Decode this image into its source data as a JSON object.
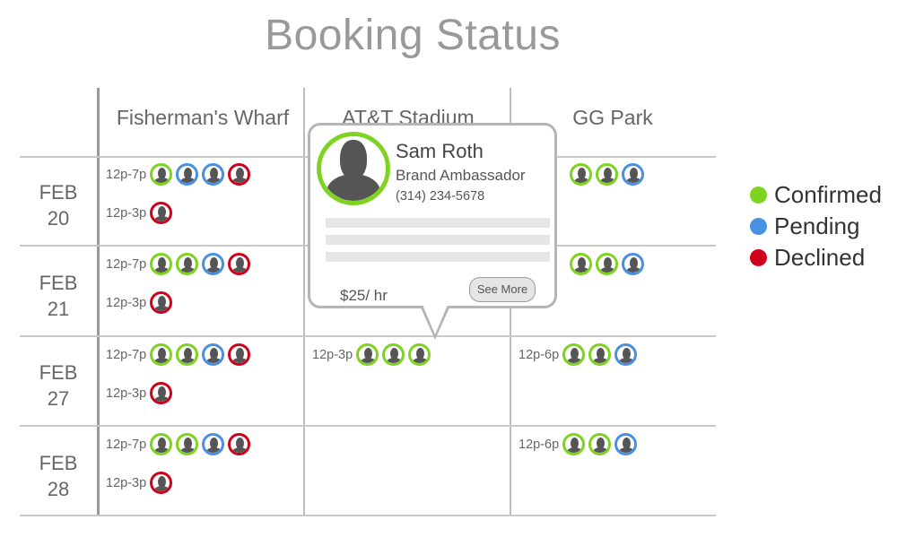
{
  "title": "Booking Status",
  "columns": [
    "Fisherman's Wharf",
    "AT&T Stadium",
    "GG Park"
  ],
  "dates": [
    {
      "month": "FEB",
      "day": "20"
    },
    {
      "month": "FEB",
      "day": "21"
    },
    {
      "month": "FEB",
      "day": "27"
    },
    {
      "month": "FEB",
      "day": "28"
    }
  ],
  "rows": [
    {
      "cells": [
        [
          {
            "time": "12p-7p",
            "people": [
              "confirmed",
              "pending",
              "pending",
              "declined"
            ]
          },
          {
            "time": "12p-3p",
            "people": [
              "declined"
            ]
          }
        ],
        [],
        [
          {
            "time": "",
            "people": [
              "confirmed",
              "confirmed",
              "pending"
            ]
          }
        ]
      ]
    },
    {
      "cells": [
        [
          {
            "time": "12p-7p",
            "people": [
              "confirmed",
              "confirmed",
              "pending",
              "declined"
            ]
          },
          {
            "time": "12p-3p",
            "people": [
              "declined"
            ]
          }
        ],
        [],
        [
          {
            "time": "",
            "people": [
              "confirmed",
              "confirmed",
              "pending"
            ]
          }
        ]
      ]
    },
    {
      "cells": [
        [
          {
            "time": "12p-7p",
            "people": [
              "confirmed",
              "confirmed",
              "pending",
              "declined"
            ]
          },
          {
            "time": "12p-3p",
            "people": [
              "declined"
            ]
          }
        ],
        [
          {
            "time": "12p-3p",
            "people": [
              "confirmed",
              "confirmed",
              "confirmed"
            ]
          }
        ],
        [
          {
            "time": "12p-6p",
            "people": [
              "confirmed",
              "confirmed",
              "pending"
            ]
          }
        ]
      ]
    },
    {
      "cells": [
        [
          {
            "time": "12p-7p",
            "people": [
              "confirmed",
              "confirmed",
              "pending",
              "declined"
            ]
          },
          {
            "time": "12p-3p",
            "people": [
              "declined"
            ]
          }
        ],
        [],
        [
          {
            "time": "12p-6p",
            "people": [
              "confirmed",
              "confirmed",
              "pending"
            ]
          }
        ]
      ]
    }
  ],
  "legend": [
    {
      "key": "confirmed",
      "label": "Confirmed",
      "color": "#7ed321"
    },
    {
      "key": "pending",
      "label": "Pending",
      "color": "#4a90e2"
    },
    {
      "key": "declined",
      "label": "Declined",
      "color": "#d0021b"
    }
  ],
  "popup": {
    "name": "Sam Roth",
    "role": "Brand Ambassador",
    "phone": "(314) 234-5678",
    "rate": "$25/ hr",
    "see_more": "See More"
  }
}
